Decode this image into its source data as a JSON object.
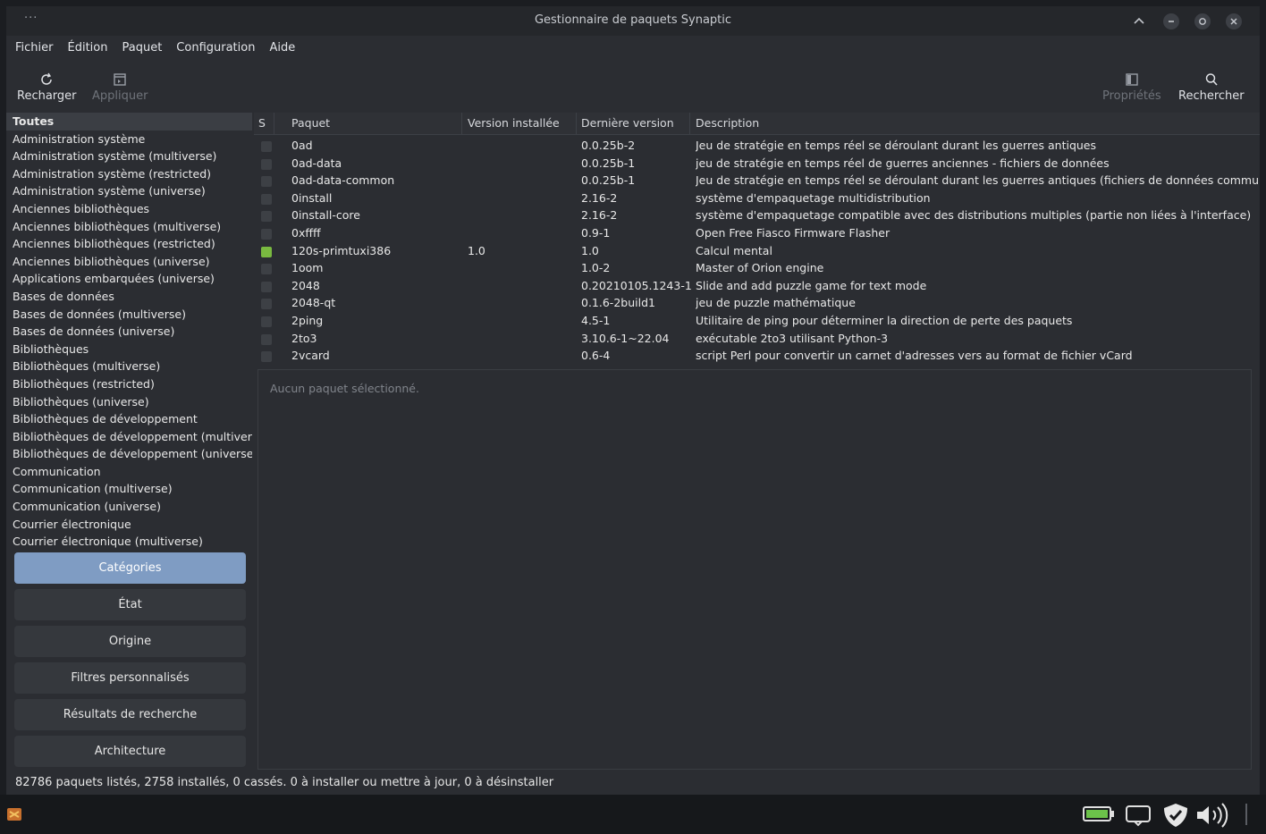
{
  "window": {
    "title": "Gestionnaire de paquets Synaptic",
    "menu_dots": "···"
  },
  "menubar": [
    "Fichier",
    "Édition",
    "Paquet",
    "Configuration",
    "Aide"
  ],
  "toolbar": {
    "reload": "Recharger",
    "apply": "Appliquer",
    "properties": "Propriétés",
    "search": "Rechercher"
  },
  "categories": [
    "Toutes",
    "Administration système",
    "Administration système (multiverse)",
    "Administration système (restricted)",
    "Administration système (universe)",
    "Anciennes bibliothèques",
    "Anciennes bibliothèques (multiverse)",
    "Anciennes bibliothèques (restricted)",
    "Anciennes bibliothèques (universe)",
    "Applications embarquées (universe)",
    "Bases de données",
    "Bases de données (multiverse)",
    "Bases de données (universe)",
    "Bibliothèques",
    "Bibliothèques (multiverse)",
    "Bibliothèques (restricted)",
    "Bibliothèques (universe)",
    "Bibliothèques de développement",
    "Bibliothèques de développement (multiver",
    "Bibliothèques de développement (universe",
    "Communication",
    "Communication (multiverse)",
    "Communication (universe)",
    "Courrier électronique",
    "Courrier électronique (multiverse)"
  ],
  "filter_buttons": {
    "categories": "Catégories",
    "state": "État",
    "origin": "Origine",
    "custom": "Filtres personnalisés",
    "search_results": "Résultats de recherche",
    "architecture": "Architecture"
  },
  "table": {
    "headers": {
      "s": "S",
      "package": "Paquet",
      "installed": "Version installée",
      "latest": "Dernière version",
      "description": "Description"
    },
    "rows": [
      {
        "installed_flag": false,
        "name": "0ad",
        "installed": "",
        "latest": "0.0.25b-2",
        "desc": "Jeu de stratégie en temps réel se déroulant durant les guerres antiques"
      },
      {
        "installed_flag": false,
        "name": "0ad-data",
        "installed": "",
        "latest": "0.0.25b-1",
        "desc": "jeu de stratégie en temps réel de guerres anciennes - fichiers de données"
      },
      {
        "installed_flag": false,
        "name": "0ad-data-common",
        "installed": "",
        "latest": "0.0.25b-1",
        "desc": "Jeu de stratégie en temps réel se déroulant durant les guerres antiques (fichiers de données communs)"
      },
      {
        "installed_flag": false,
        "name": "0install",
        "installed": "",
        "latest": "2.16-2",
        "desc": "système d'empaquetage multidistribution"
      },
      {
        "installed_flag": false,
        "name": "0install-core",
        "installed": "",
        "latest": "2.16-2",
        "desc": "système d'empaquetage compatible avec des distributions multiples (partie non liées à l'interface)"
      },
      {
        "installed_flag": false,
        "name": "0xffff",
        "installed": "",
        "latest": "0.9-1",
        "desc": "Open Free Fiasco Firmware Flasher"
      },
      {
        "installed_flag": true,
        "name": "120s-primtuxi386",
        "installed": "1.0",
        "latest": "1.0",
        "desc": "Calcul mental"
      },
      {
        "installed_flag": false,
        "name": "1oom",
        "installed": "",
        "latest": "1.0-2",
        "desc": "Master of Orion engine"
      },
      {
        "installed_flag": false,
        "name": "2048",
        "installed": "",
        "latest": "0.20210105.1243-1",
        "desc": "Slide and add puzzle game for text mode"
      },
      {
        "installed_flag": false,
        "name": "2048-qt",
        "installed": "",
        "latest": "0.1.6-2build1",
        "desc": "jeu de puzzle mathématique"
      },
      {
        "installed_flag": false,
        "name": "2ping",
        "installed": "",
        "latest": "4.5-1",
        "desc": "Utilitaire de ping pour déterminer la direction de perte des paquets"
      },
      {
        "installed_flag": false,
        "name": "2to3",
        "installed": "",
        "latest": "3.10.6-1~22.04",
        "desc": "exécutable 2to3 utilisant Python-3"
      },
      {
        "installed_flag": false,
        "name": "2vcard",
        "installed": "",
        "latest": "0.6-4",
        "desc": "script Perl pour convertir un carnet d'adresses vers au format de fichier vCard"
      }
    ]
  },
  "details": {
    "empty_message": "Aucun paquet sélectionné."
  },
  "statusbar": {
    "text": "82786 paquets listés, 2758 installés, 0 cassés. 0 à installer ou mettre à jour, 0 à désinstaller"
  },
  "colors": {
    "accent": "#7f9cc3",
    "installed": "#79b940",
    "battery": "#6cc24a"
  },
  "tray_icons": [
    "battery-icon",
    "display-icon",
    "shield-icon",
    "volume-icon"
  ]
}
